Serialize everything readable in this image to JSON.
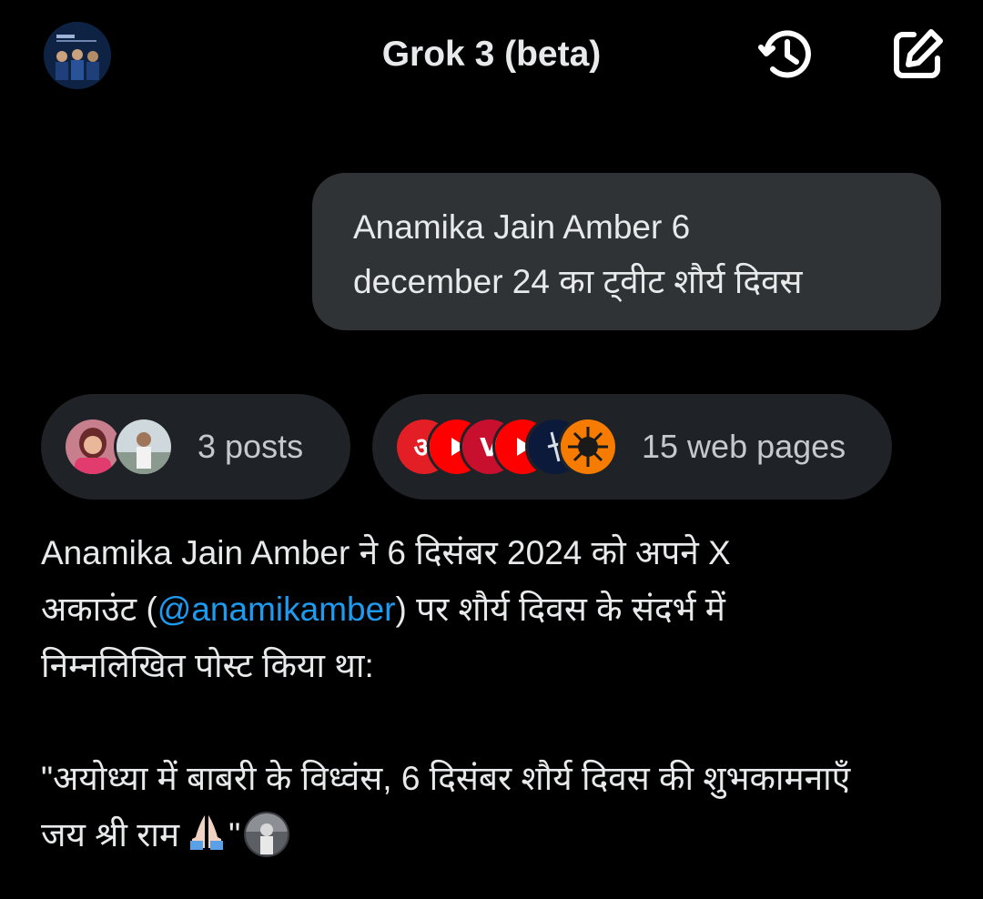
{
  "header": {
    "title": "Grok 3 (beta)",
    "avatar_icon": "profile-avatar",
    "history_icon": "history-icon",
    "edit_icon": "new-chat-edit-icon"
  },
  "user_message": {
    "line1": "Anamika Jain Amber 6",
    "line2": "december 24 का ट्वीट शौर्य दिवस"
  },
  "sources": {
    "posts_label": "3 posts",
    "web_label": "15 web pages"
  },
  "response": {
    "line1": "Anamika Jain Amber ने 6 दिसंबर 2024 को अपने X",
    "line2_prefix": "अकाउंट (",
    "mention": "@anamikamber",
    "line2_suffix": ") पर शौर्य दिवस के संदर्भ में",
    "line3": "निम्नलिखित पोस्ट किया था:",
    "quote_line1": "\"अयोध्या में बाबरी के विध्वंस, 6 दिसंबर शौर्य दिवस की शुभकामनाएँ",
    "quote_line2": "जय श्री राम",
    "quote_end": "\""
  },
  "colors": {
    "background": "#000000",
    "bubble": "#2f3336",
    "chip": "#1f2226",
    "mention": "#1d9bf0",
    "text": "#e7e9ea"
  }
}
